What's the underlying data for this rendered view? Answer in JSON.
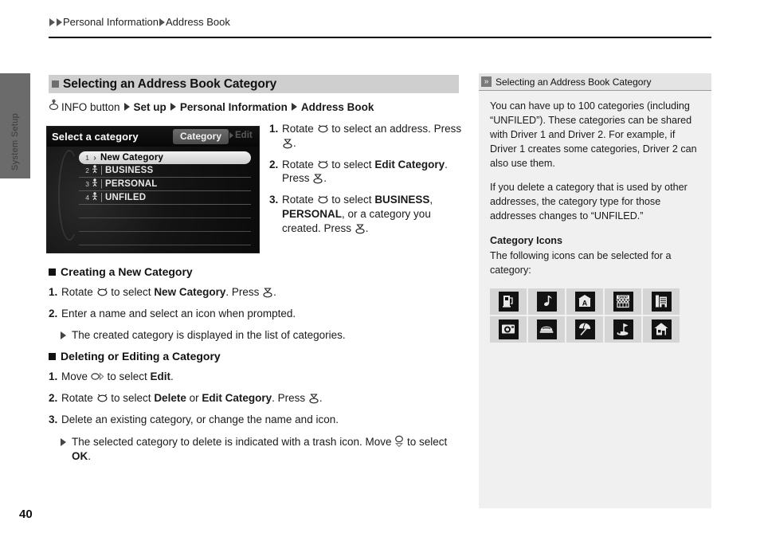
{
  "page": {
    "number": "40",
    "side_tab_label": "System Setup"
  },
  "breadcrumb": {
    "items": [
      "Personal Information",
      "Address Book"
    ],
    "arrow_icon": "triangle-right-icon"
  },
  "heading": {
    "marker_icon": "square-bullet-icon",
    "title": "Selecting an Address Book Category"
  },
  "nav_path": {
    "knob_icon": "rotary-knob-icon",
    "segments": [
      {
        "label": "INFO button",
        "bold": false
      },
      {
        "label": "Set up",
        "bold": true
      },
      {
        "label": "Personal Information",
        "bold": true
      },
      {
        "label": "Address Book",
        "bold": true
      }
    ],
    "separator_icon": "triangle-right-icon"
  },
  "screen": {
    "title": "Select a category",
    "tab_label": "Category",
    "edit_label": "Edit",
    "edit_arrow_icon": "triangle-right-icon",
    "rows": [
      {
        "num": "1",
        "marker": "›",
        "name": "New Category",
        "selected": true
      },
      {
        "num": "2",
        "marker": "person-icon",
        "name": "BUSINESS",
        "selected": false
      },
      {
        "num": "3",
        "marker": "person-icon",
        "name": "PERSONAL",
        "selected": false
      },
      {
        "num": "4",
        "marker": "person-icon",
        "name": "UNFILED",
        "selected": false
      }
    ]
  },
  "steps_right": [
    {
      "n": "1.",
      "parts": [
        {
          "t": "Rotate ",
          "b": false
        },
        {
          "t": "knob-icon",
          "b": false,
          "icon": "rotary-knob-icon"
        },
        {
          "t": " to select an address. Press ",
          "b": false
        },
        {
          "t": "enter-icon",
          "b": false,
          "icon": "press-knob-icon"
        },
        {
          "t": ".",
          "b": false
        }
      ]
    },
    {
      "n": "2.",
      "parts": [
        {
          "t": "Rotate ",
          "b": false
        },
        {
          "t": "knob-icon",
          "b": false,
          "icon": "rotary-knob-icon"
        },
        {
          "t": " to select ",
          "b": false
        },
        {
          "t": "Edit Category",
          "b": true
        },
        {
          "t": ". Press ",
          "b": false
        },
        {
          "t": "enter-icon",
          "b": false,
          "icon": "press-knob-icon"
        },
        {
          "t": ".",
          "b": false
        }
      ]
    },
    {
      "n": "3.",
      "parts": [
        {
          "t": "Rotate ",
          "b": false
        },
        {
          "t": "knob-icon",
          "b": false,
          "icon": "rotary-knob-icon"
        },
        {
          "t": " to select ",
          "b": false
        },
        {
          "t": "BUSINESS",
          "b": true
        },
        {
          "t": ", ",
          "b": false
        },
        {
          "t": "PERSONAL",
          "b": true
        },
        {
          "t": ", or a category you created. Press ",
          "b": false
        },
        {
          "t": "enter-icon",
          "b": false,
          "icon": "press-knob-icon"
        },
        {
          "t": ".",
          "b": false
        }
      ]
    }
  ],
  "section_creating": {
    "title": "Creating a New Category",
    "steps": [
      {
        "n": "1.",
        "parts": [
          {
            "t": "Rotate ",
            "b": false
          },
          {
            "t": "knob-icon",
            "b": false,
            "icon": "rotary-knob-icon"
          },
          {
            "t": " to select ",
            "b": false
          },
          {
            "t": "New Category",
            "b": true
          },
          {
            "t": ". Press ",
            "b": false
          },
          {
            "t": "enter-icon",
            "b": false,
            "icon": "press-knob-icon"
          },
          {
            "t": ".",
            "b": false
          }
        ]
      },
      {
        "n": "2.",
        "parts": [
          {
            "t": "Enter a name and select an icon when prompted.",
            "b": false
          }
        ]
      }
    ],
    "note": "The created category is displayed in the list of categories."
  },
  "section_deleting": {
    "title": "Deleting or Editing a Category",
    "steps": [
      {
        "n": "1.",
        "parts": [
          {
            "t": "Move ",
            "b": false
          },
          {
            "t": "move-right-icon",
            "b": false,
            "icon": "knob-move-right-icon"
          },
          {
            "t": " to select ",
            "b": false
          },
          {
            "t": "Edit",
            "b": true
          },
          {
            "t": ".",
            "b": false
          }
        ]
      },
      {
        "n": "2.",
        "parts": [
          {
            "t": "Rotate ",
            "b": false
          },
          {
            "t": "knob-icon",
            "b": false,
            "icon": "rotary-knob-icon"
          },
          {
            "t": " to select ",
            "b": false
          },
          {
            "t": "Delete",
            "b": true
          },
          {
            "t": " or ",
            "b": false
          },
          {
            "t": "Edit Category",
            "b": true
          },
          {
            "t": ". Press ",
            "b": false
          },
          {
            "t": "enter-icon",
            "b": false,
            "icon": "press-knob-icon"
          },
          {
            "t": ".",
            "b": false
          }
        ]
      },
      {
        "n": "3.",
        "parts": [
          {
            "t": "Delete an existing category, or change the name and icon.",
            "b": false
          }
        ]
      }
    ],
    "note_parts": [
      {
        "t": "The selected category to delete is indicated with a trash icon. Move ",
        "b": false
      },
      {
        "t": "move-down-icon",
        "b": false,
        "icon": "knob-move-down-icon"
      },
      {
        "t": " to select ",
        "b": false
      },
      {
        "t": "OK",
        "b": true
      },
      {
        "t": ".",
        "b": false
      }
    ]
  },
  "sidebar": {
    "chevron_icon": "double-chevron-right-icon",
    "header": "Selecting an Address Book Category",
    "paragraphs": [
      "You can have up to 100 categories (including “UNFILED”). These categories can be shared with Driver 1 and Driver 2. For example, if Driver 1 creates some categories, Driver 2 can also use them.",
      "If you delete a category that is used by other addresses, the category type for those addresses changes to “UNFILED.”"
    ],
    "icons_heading": "Category Icons",
    "icons_intro": "The following icons can be selected for a category:",
    "icons": [
      {
        "name": "fuel-pump-icon",
        "glyph": "⛽"
      },
      {
        "name": "music-note-icon",
        "glyph": "♪"
      },
      {
        "name": "school-building-icon",
        "glyph": "A"
      },
      {
        "name": "shop-storefront-icon",
        "glyph": "SHOP"
      },
      {
        "name": "office-building-icon",
        "glyph": "▤"
      },
      {
        "name": "camera-icon",
        "glyph": "◉"
      },
      {
        "name": "car-icon",
        "glyph": "▬"
      },
      {
        "name": "beach-umbrella-icon",
        "glyph": "☂"
      },
      {
        "name": "golf-flag-icon",
        "glyph": "⛳"
      },
      {
        "name": "home-house-icon",
        "glyph": "⌂"
      }
    ]
  },
  "colors": {
    "heading_bar": "#cfcfcf",
    "sidebar_bg": "#f0f0f0",
    "sidebar_head_bg": "#e4e4e4",
    "side_tab": "#6b6b6b",
    "screen_bg": "#0d0d0d"
  }
}
